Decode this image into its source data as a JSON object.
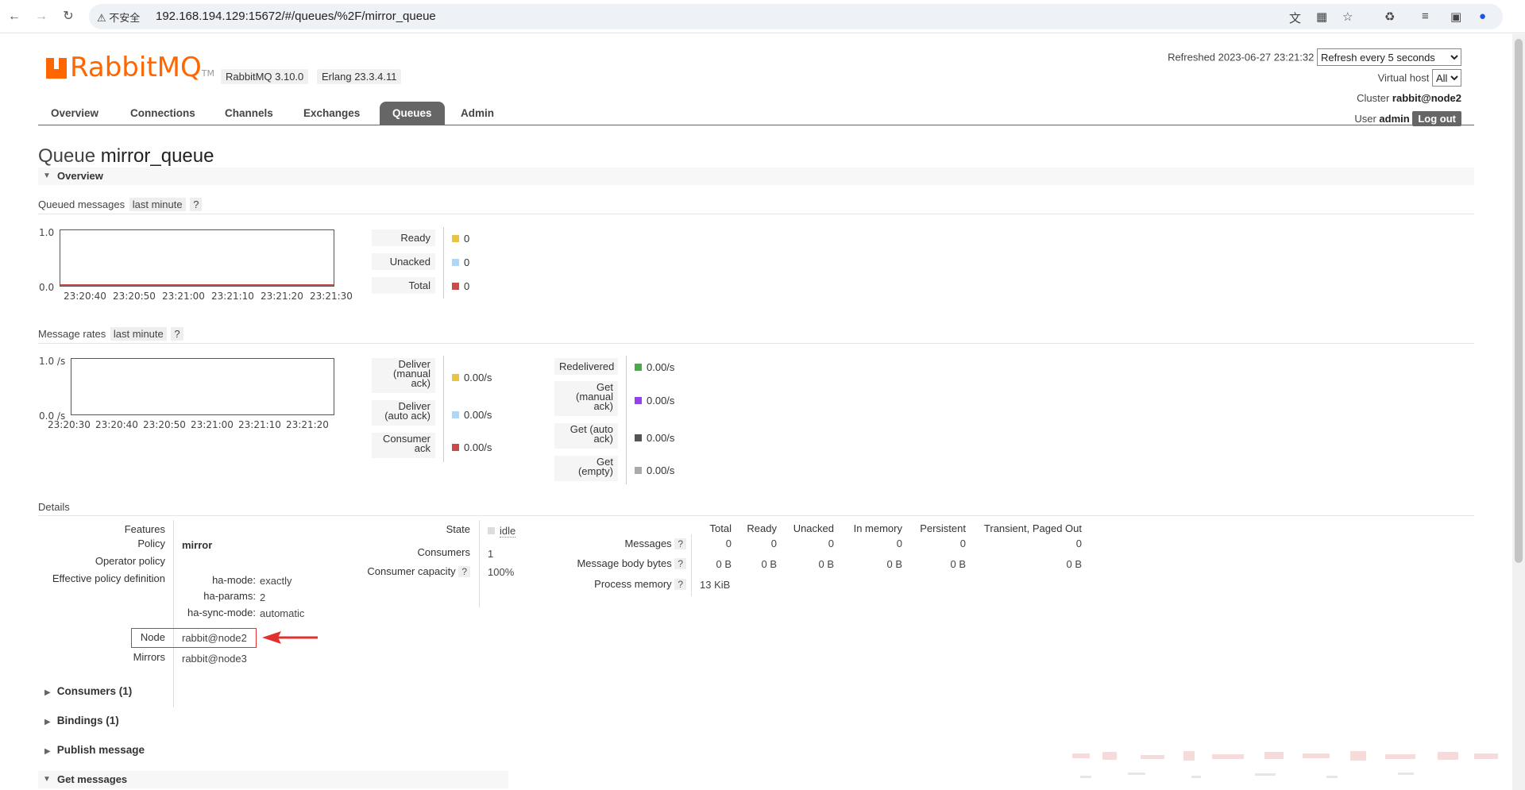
{
  "browser": {
    "insecure_label": "不安全",
    "url": "192.168.194.129:15672/#/queues/%2F/mirror_queue"
  },
  "header": {
    "brand": "RabbitMQ",
    "tm": "TM",
    "version": "RabbitMQ 3.10.0",
    "erlang": "Erlang 23.3.4.11",
    "refreshed_label": "Refreshed 2023-06-27 23:21:32",
    "refresh_option": "Refresh every 5 seconds",
    "vhost_label": "Virtual host",
    "vhost_option": "All",
    "cluster_label": "Cluster",
    "cluster_value": "rabbit@node2",
    "user_label": "User",
    "user_value": "admin",
    "logout": "Log out"
  },
  "tabs": [
    {
      "label": "Overview"
    },
    {
      "label": "Connections"
    },
    {
      "label": "Channels"
    },
    {
      "label": "Exchanges"
    },
    {
      "label": "Queues"
    },
    {
      "label": "Admin"
    }
  ],
  "title": {
    "prefix": "Queue",
    "name": "mirror_queue"
  },
  "overview": {
    "header": "Overview",
    "queued": {
      "label": "Queued messages",
      "range": "last minute",
      "help": "?",
      "y_max": "1.0",
      "y_min": "0.0",
      "x_ticks": [
        "23:20:40",
        "23:20:50",
        "23:21:00",
        "23:21:10",
        "23:21:20",
        "23:21:30"
      ],
      "legend": [
        {
          "label": "Ready",
          "value": "0",
          "color": "#edc240"
        },
        {
          "label": "Unacked",
          "value": "0",
          "color": "#afd8f8"
        },
        {
          "label": "Total",
          "value": "0",
          "color": "#cb4b4b"
        }
      ]
    },
    "rates": {
      "label": "Message rates",
      "range": "last minute",
      "help": "?",
      "y_max": "1.0 /s",
      "y_min": "0.0 /s",
      "x_ticks": [
        "23:20:30",
        "23:20:40",
        "23:20:50",
        "23:21:00",
        "23:21:10",
        "23:21:20"
      ],
      "legend_left": [
        {
          "lines": [
            "Deliver",
            "(manual",
            "ack)"
          ],
          "value": "0.00/s",
          "color": "#edc240"
        },
        {
          "lines": [
            "Deliver",
            "(auto ack)"
          ],
          "value": "0.00/s",
          "color": "#afd8f8"
        },
        {
          "lines": [
            "Consumer",
            "ack"
          ],
          "value": "0.00/s",
          "color": "#cb4b4b"
        }
      ],
      "legend_right": [
        {
          "lines": [
            "Redelivered"
          ],
          "value": "0.00/s",
          "color": "#4da74d"
        },
        {
          "lines": [
            "Get",
            "(manual",
            "ack)"
          ],
          "value": "0.00/s",
          "color": "#9440ed"
        },
        {
          "lines": [
            "Get (auto",
            "ack)"
          ],
          "value": "0.00/s",
          "color": "#555555"
        },
        {
          "lines": [
            "Get",
            "(empty)"
          ],
          "value": "0.00/s",
          "color": "#aaaaaa"
        }
      ]
    }
  },
  "details": {
    "header": "Details",
    "features_label": "Features",
    "policy_label": "Policy",
    "policy_value": "mirror",
    "operator_policy_label": "Operator policy",
    "effective_label": "Effective policy definition",
    "ha_mode_label": "ha-mode:",
    "ha_mode_value": "exactly",
    "ha_params_label": "ha-params:",
    "ha_params_value": "2",
    "ha_sync_label": "ha-sync-mode:",
    "ha_sync_value": "automatic",
    "node_label": "Node",
    "node_value": "rabbit@node2",
    "mirrors_label": "Mirrors",
    "mirrors_value": "rabbit@node3",
    "state_label": "State",
    "state_value": "idle",
    "consumers_label": "Consumers",
    "consumers_value": "1",
    "capacity_label": "Consumer capacity",
    "capacity_value": "100%",
    "stats_headers": [
      "Total",
      "Ready",
      "Unacked",
      "In memory",
      "Persistent",
      "Transient, Paged Out"
    ],
    "messages_label": "Messages",
    "messages_values": [
      "0",
      "0",
      "0",
      "0",
      "0",
      "0"
    ],
    "body_bytes_label": "Message body bytes",
    "body_bytes_values": [
      "0 B",
      "0 B",
      "0 B",
      "0 B",
      "0 B",
      "0 B"
    ],
    "process_memory_label": "Process memory",
    "process_memory_value": "13 KiB"
  },
  "sections": {
    "consumers": "Consumers (1)",
    "bindings": "Bindings (1)",
    "publish": "Publish message",
    "get": "Get messages"
  }
}
